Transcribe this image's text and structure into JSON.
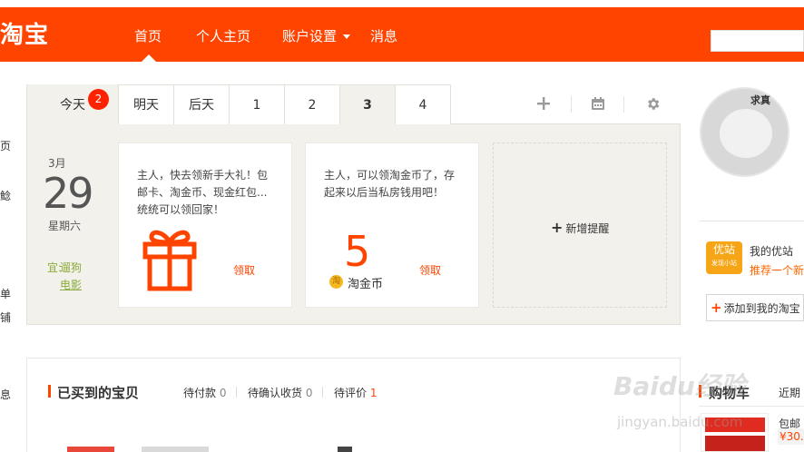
{
  "header": {
    "logo": "淘宝",
    "nav": [
      "首页",
      "个人主页",
      "账户设置",
      "消息"
    ]
  },
  "sidebar_fragments": [
    "页",
    "鲶",
    "单",
    "铺",
    "息"
  ],
  "calendar": {
    "tabs": [
      "今天",
      "明天",
      "后天",
      "1",
      "2",
      "3",
      "4"
    ],
    "today_badge": "2",
    "tool_icons": [
      "add-icon",
      "calendar-icon",
      "gear-icon"
    ],
    "month": "3月",
    "day": "29",
    "weekday": "星期六",
    "yi_label": "宜:",
    "yi_items": [
      "遛狗",
      "电影"
    ]
  },
  "cards": [
    {
      "text_lines": [
        "主人，快去领新手大礼！包",
        "邮卡、淘金币、现金红包...",
        "统统可以领回家！"
      ],
      "icon": "gift-icon",
      "action": "领取"
    },
    {
      "text_lines": [
        "主人，可以领淘金币了，存",
        "起来以后当私房钱用吧！"
      ],
      "number": "5",
      "coin_glyph": "淘",
      "coin_label": "淘金币",
      "action": "领取"
    }
  ],
  "add_reminder": {
    "plus": "+",
    "label": "新增提醒"
  },
  "right": {
    "avatar_text": "求真",
    "youzhan_icon": "优站",
    "youzhan_icon_sub": "发现小站",
    "youzhan_title": "我的优站",
    "youzhan_link": "推荐一个新",
    "add_label": "添加到我的淘宝",
    "add_plus": "+"
  },
  "bought": {
    "title": "已买到的宝贝",
    "stats": [
      {
        "label": "待付款",
        "num": "0"
      },
      {
        "label": "待确认收货",
        "num": "0"
      },
      {
        "label": "待评价",
        "num": "1"
      }
    ]
  },
  "cart": {
    "title": "购物车",
    "recent": "近期",
    "ship": "包邮中",
    "price": "¥30."
  },
  "watermark": {
    "main": "Baidu经验",
    "sub": "jingyan.baidu.com"
  }
}
